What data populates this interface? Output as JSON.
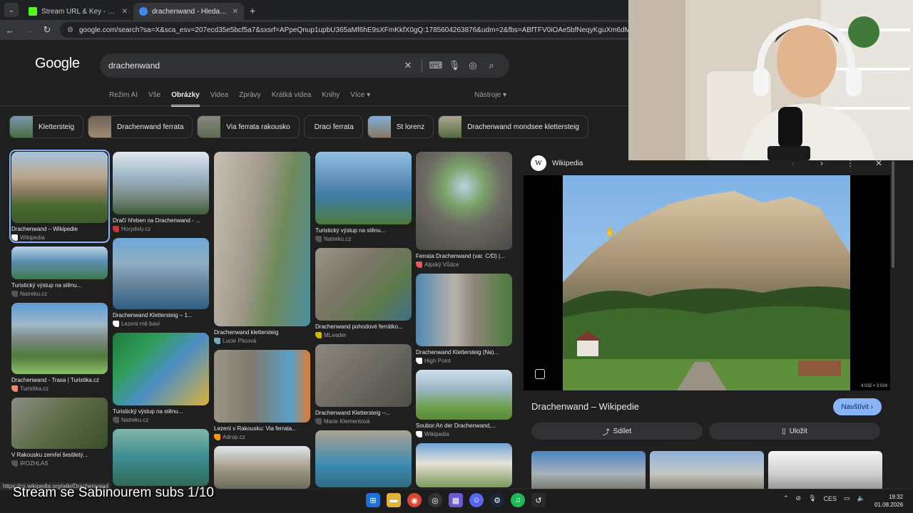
{
  "browser": {
    "tabs": [
      {
        "title": "Stream URL & Key - Kick Dashb",
        "favicon_color": "#53fc18",
        "active": false
      },
      {
        "title": "drachenwand - Hledat Googlem",
        "favicon_color": "#4285f4",
        "active": true
      }
    ],
    "url": "google.com/search?sa=X&sca_esv=207ecd35e5bcf5a7&sxsrf=APpeQnup1upbU365aMf6hE9sXFmKkfX0gQ:1785604263876&udm=2&fbs=ABfTFV0iOAe5bfNeqyKguXm6dMy_0ApBOceFC"
  },
  "google": {
    "logo": "Google",
    "query": "drachenwand",
    "tabs": [
      "Režim AI",
      "Vše",
      "Obrázky",
      "Videa",
      "Zprávy",
      "Krátká videa",
      "Knihy",
      "Více"
    ],
    "active_tab": "Obrázky",
    "tools_label": "Nástroje",
    "chips": [
      "Klettersteig",
      "Drachenwand ferrata",
      "Via ferrata rakousko",
      "Draci ferrata",
      "St lorenz",
      "Drachenwand mondsee klettersteig"
    ]
  },
  "results": {
    "col1": [
      {
        "caption": "Drachenwand – Wikipedie",
        "source": "Wikipedia"
      },
      {
        "caption": "Turistický výstup na stěnu...",
        "source": "Natreku.cz"
      },
      {
        "caption": "Drachenwand - Trasa | Turistika.cz",
        "source": "Turistika.cz"
      },
      {
        "caption": "V Rakousku zemřel šestiletý...",
        "source": "iROZHLAS"
      }
    ],
    "col2": [
      {
        "caption": "Dračí hřeben na Drachenwand - ...",
        "source": "Horydoly.cz"
      },
      {
        "caption": "Drachenwand Klettersteig – 1...",
        "source": "Lezeni mě baví"
      },
      {
        "caption": "Turistický výstup na stěnu...",
        "source": "Natreku.cz"
      }
    ],
    "col3": [
      {
        "caption": "Drachenwand klettersteig",
        "source": "Lucie Plicová"
      },
      {
        "caption": "Lezení v Rakousku: Via ferrata...",
        "source": "Adrop.cz"
      }
    ],
    "col4": [
      {
        "caption": "Turistický výstup na stěnu...",
        "source": "Natreku.cz"
      },
      {
        "caption": "Drachenwand pohodové ferrátko...",
        "source": "MLeader"
      },
      {
        "caption": "Drachenwand Klettersteig –...",
        "source": "Marie Klementová"
      }
    ],
    "col5": [
      {
        "caption": "Ferrata Drachenwand (var. C/D) |...",
        "source": "Alpský Vůdce"
      },
      {
        "caption": "Drachenwand Klettersteig (Na)...",
        "source": "High Point"
      },
      {
        "caption": "Soubor:An der Drachenwand,...",
        "source": "Wikipedia"
      }
    ]
  },
  "panel": {
    "source_name": "Wikipedia",
    "source_logo": "W",
    "dimensions": "4 032 × 3 024",
    "title": "Drachenwand – Wikipedie",
    "visit_label": "Navštívit",
    "share_label": "Sdílet",
    "save_label": "Uložit"
  },
  "overlay": {
    "status_url": "https://cs.wikipedia.org/wiki/Drachenwand",
    "subtitle": "Stream se Sabinourem subs 1/10"
  },
  "taskbar": {
    "lang": "CES",
    "time": "19:32",
    "date": "01.08.2026"
  }
}
